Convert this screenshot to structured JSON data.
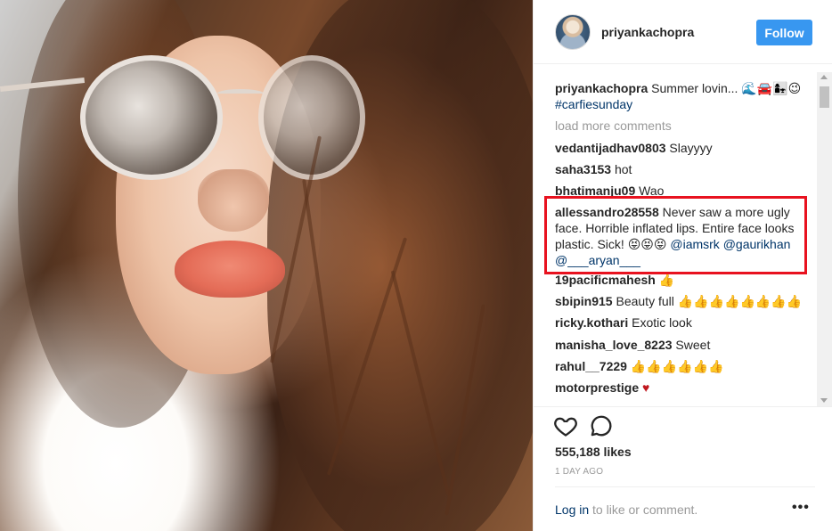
{
  "post": {
    "author": "priyankachopra",
    "follow_label": "Follow",
    "caption": {
      "user": "priyankachopra",
      "text": "Summer lovin...",
      "emoji": "🌊🚘👩‍👧😉",
      "hashtag": "#carfiesunday"
    },
    "load_more_label": "load more comments",
    "comments": [
      {
        "user": "vedantijadhav0803",
        "text": "Slayyyy"
      },
      {
        "user": "saha3153",
        "text": "hot"
      },
      {
        "user": "bhatimanju09",
        "text": "Wao"
      },
      {
        "user": "allessandro28558",
        "text": "Never saw a more ugly face. Horrible inflated lips. Entire face looks plastic. Sick! 😝😝😝 ",
        "mentions": "@iamsrk @gaurikhan @___aryan___"
      },
      {
        "user": "19pacificmahesh",
        "text": "👍"
      },
      {
        "user": "sbipin915",
        "text": "Beauty full 👍👍👍👍👍👍👍👍"
      },
      {
        "user": "ricky.kothari",
        "text": "Exotic look"
      },
      {
        "user": "manisha_love_8223",
        "text": "Sweet"
      },
      {
        "user": "rahul__7229",
        "text": "👍👍👍👍👍👍"
      },
      {
        "user": "motorprestige",
        "text": "♥"
      }
    ],
    "likes": "555,188 likes",
    "timestamp": "1 DAY AGO",
    "login_link": "Log in",
    "login_suffix": " to like or comment.",
    "more_options": "•••",
    "icons": {
      "like": "heart-icon",
      "comment": "comment-icon",
      "more": "more-options-icon"
    }
  },
  "colors": {
    "follow_button": "#3897f0",
    "link": "#003569",
    "muted": "#999999",
    "highlight_box": "#e8121f"
  }
}
